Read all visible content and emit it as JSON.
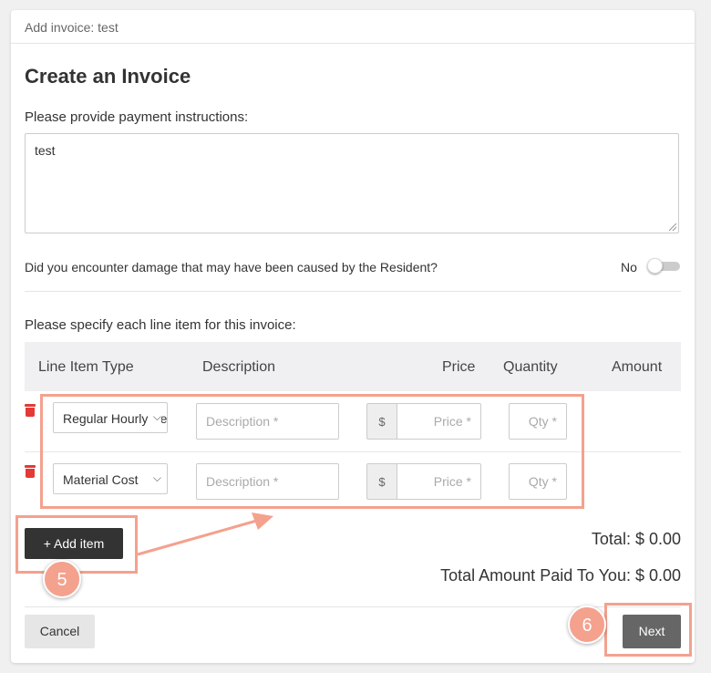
{
  "header": {
    "title": "Add invoice: test"
  },
  "form": {
    "heading": "Create an Invoice",
    "instructions_label": "Please provide payment instructions:",
    "instructions_value": "test",
    "damage_question": "Did you encounter damage that may have been caused by the Resident?",
    "damage_toggle_label": "No",
    "line_items_label": "Please specify each line item for this invoice:"
  },
  "table": {
    "columns": [
      "Line Item Type",
      "Description",
      "Price",
      "Quantity",
      "Amount"
    ],
    "rows": [
      {
        "type": "Regular Hourly Se",
        "description_placeholder": "Description *",
        "currency": "$",
        "price_placeholder": "Price *",
        "qty_placeholder": "Qty *"
      },
      {
        "type": "Material Cost",
        "description_placeholder": "Description *",
        "currency": "$",
        "price_placeholder": "Price *",
        "qty_placeholder": "Qty *"
      }
    ]
  },
  "actions": {
    "add_item": "+ Add item",
    "total": "Total: $ 0.00",
    "total_paid": "Total Amount Paid To You: $ 0.00",
    "cancel": "Cancel",
    "next": "Next"
  },
  "annotations": {
    "step_add": "5",
    "step_next": "6"
  },
  "colors": {
    "highlight": "#f4a18e",
    "delete": "#e53935",
    "dark_button": "#333333",
    "next_button": "#666666"
  }
}
